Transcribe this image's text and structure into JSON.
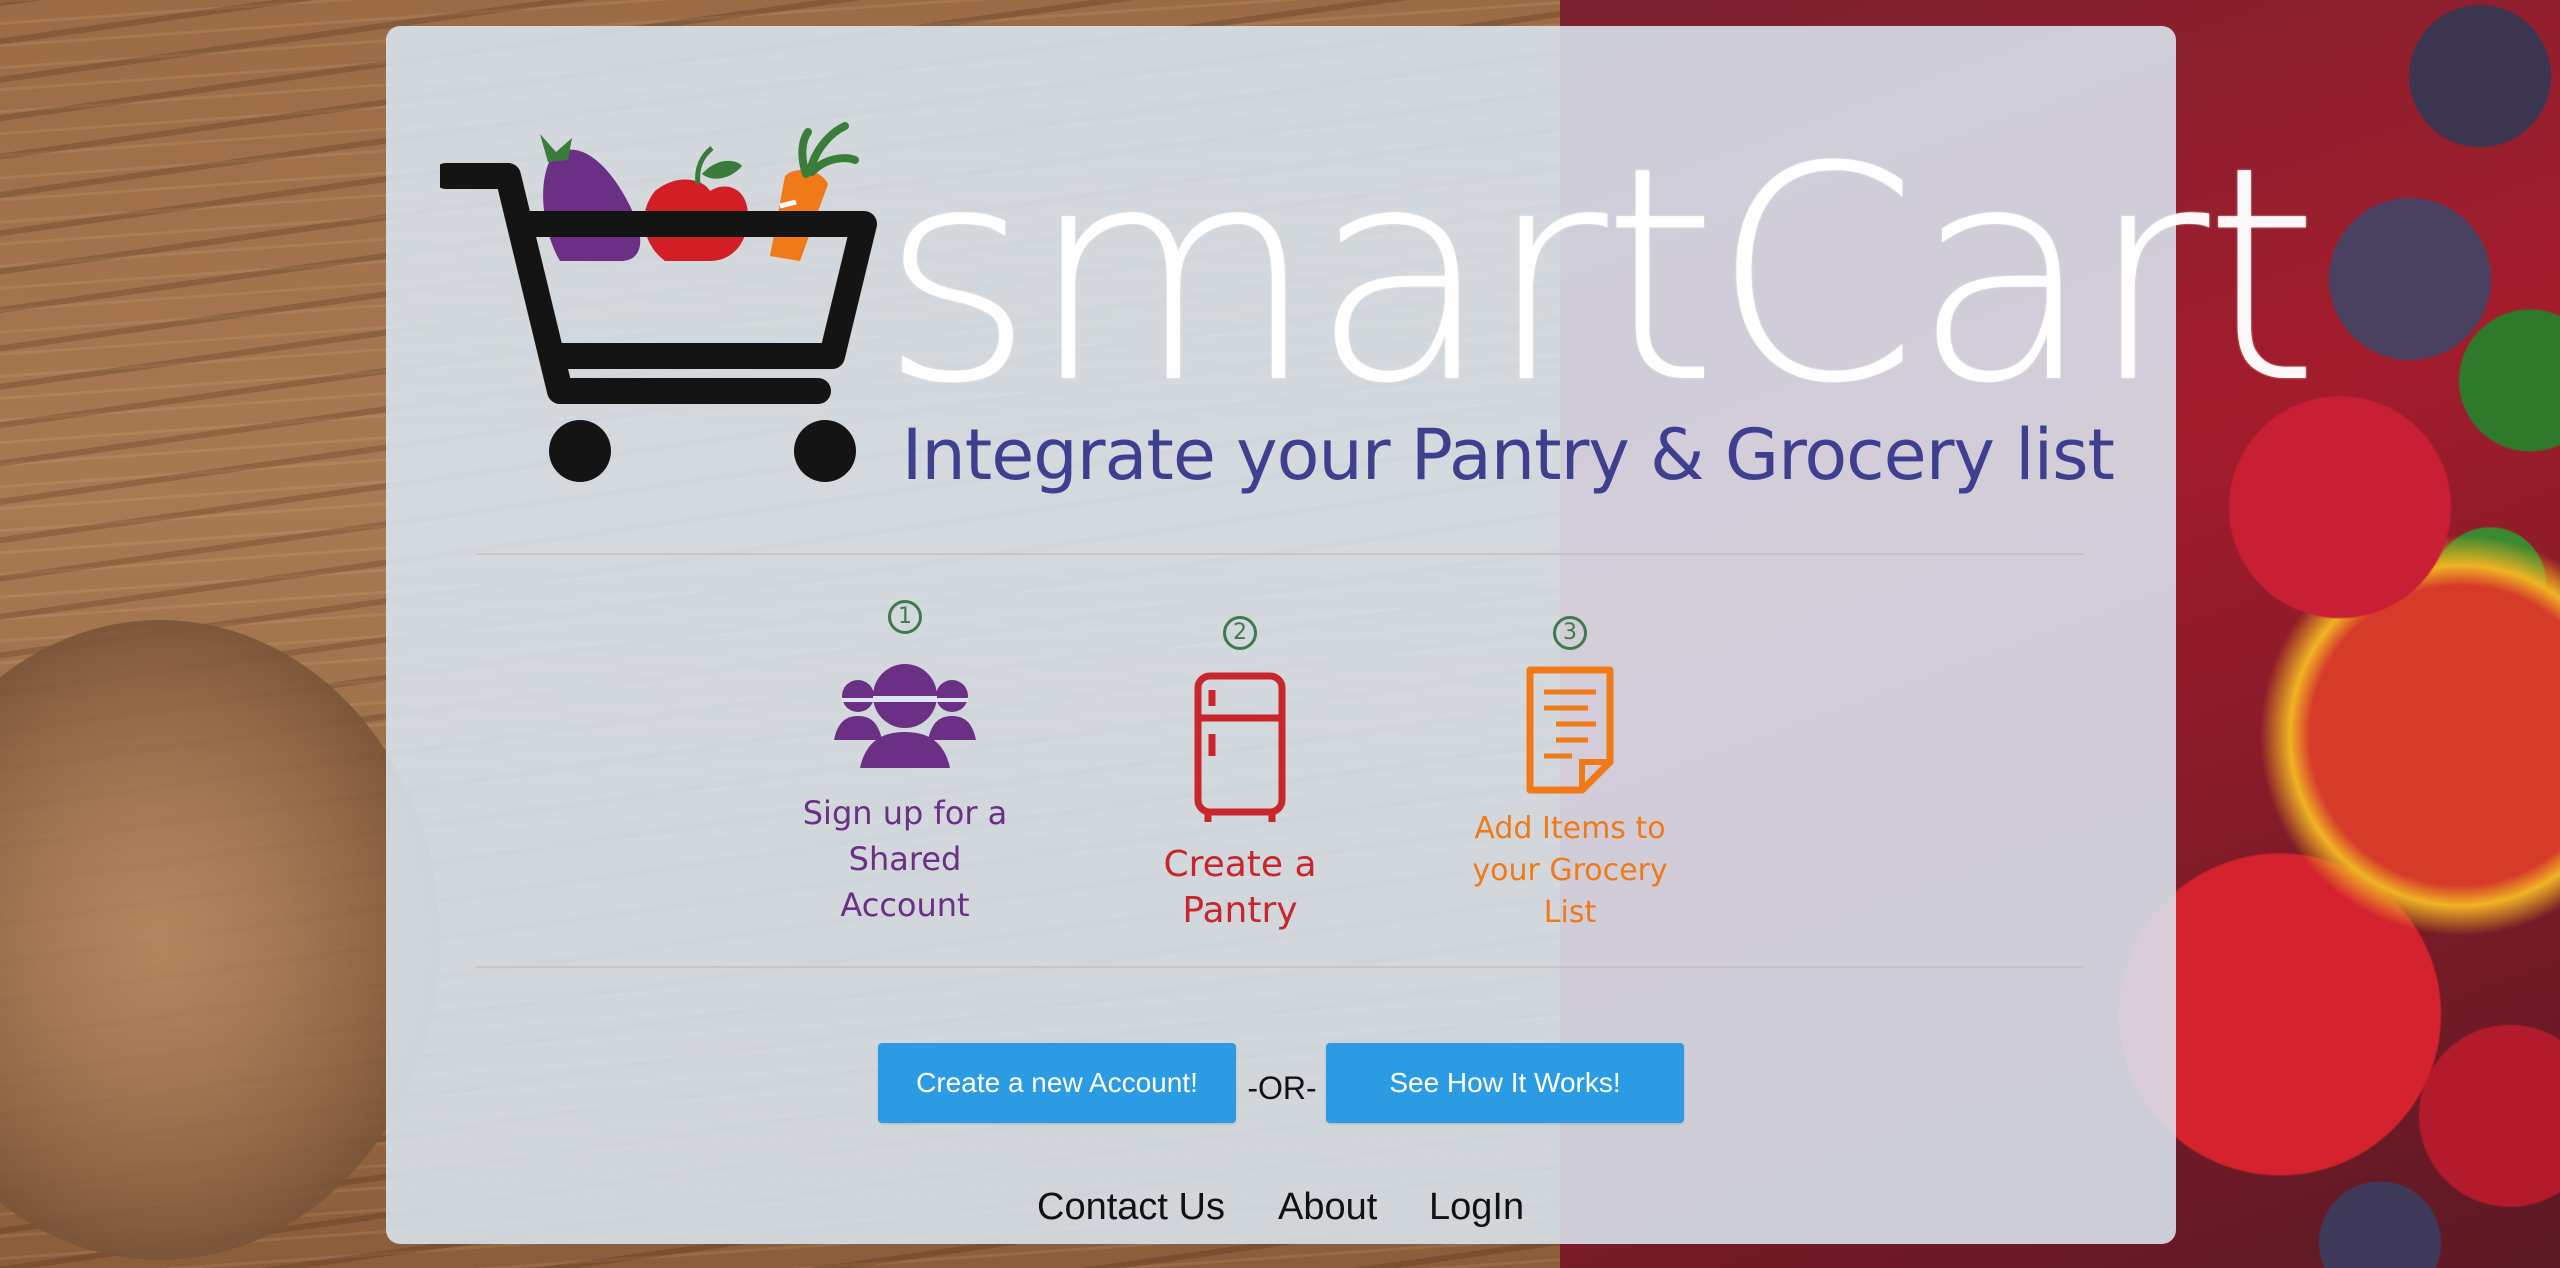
{
  "brand": {
    "name": "smartCart",
    "tagline": "Integrate your Pantry & Grocery list"
  },
  "steps": [
    {
      "number": "1",
      "label_line1": "Sign up for a",
      "label_line2": "Shared Account",
      "color": "#6b2f86",
      "icon": "users-group-icon"
    },
    {
      "number": "2",
      "label_line1": "Create a Pantry",
      "label_line2": "",
      "color": "#c8262c",
      "icon": "refrigerator-icon"
    },
    {
      "number": "3",
      "label_line1": "Add Items to",
      "label_line2": "your Grocery List",
      "color": "#f07a18",
      "icon": "list-document-icon"
    }
  ],
  "actions": {
    "create_account_label": "Create a new Account!",
    "or_text": "-OR-",
    "how_it_works_label": "See How It Works!"
  },
  "footer": {
    "links": [
      "Contact Us",
      "About",
      "LogIn"
    ]
  },
  "colors": {
    "accent_button": "#2b9be3",
    "tagline": "#3f3f8f",
    "step_number": "#3e7a4d"
  }
}
